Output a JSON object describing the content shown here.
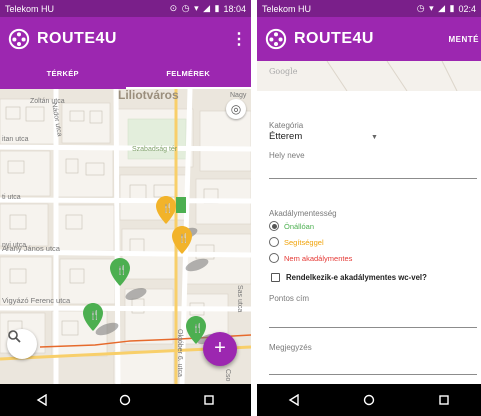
{
  "left": {
    "status": {
      "carrier": "Telekom HU",
      "icons": "⊙ ◷ ▾ ◢ ▮",
      "time": "18:04"
    },
    "appbar": {
      "brand": "ROUTE4U",
      "menu": "⋮"
    },
    "tabs": [
      {
        "label": "TÉRKÉP",
        "active": false
      },
      {
        "label": "FELMÉREK",
        "active": true
      }
    ],
    "map": {
      "streets": [
        "Zoltán utca",
        "Nádor utca",
        "Liliotváros",
        "Szabadság tér",
        "Arany János utca",
        "Vigyázó Ferenc utca",
        "Október 6. utca",
        "Sas utca",
        "Nagy",
        "itan utca",
        "nyi utca",
        "ti utca",
        "Cso"
      ],
      "pins": [
        "accessible",
        "partially-accessible",
        "partially-accessible",
        "accessible",
        "accessible",
        "accessible"
      ]
    },
    "colors": {
      "accessible": "#4caf50",
      "partial": "#f2b32a"
    }
  },
  "right": {
    "status": {
      "carrier": "Telekom HU",
      "icons": "◷ ▾ ◢ ▮",
      "time": "02:4"
    },
    "appbar": {
      "brand": "ROUTE4U",
      "save": "MENTÉ"
    },
    "map_watermark": "Google",
    "form": {
      "category_label": "Kategória",
      "category_value": "Étterem",
      "place_label": "Hely neve",
      "place_value": "",
      "accessibility_label": "Akadálymentesség",
      "options": [
        {
          "label": "Önállóan",
          "color": "#4caf50",
          "selected": true
        },
        {
          "label": "Segítséggel",
          "color": "#f0a30a",
          "selected": false
        },
        {
          "label": "Nem akadálymentes",
          "color": "#e53935",
          "selected": false
        }
      ],
      "wc_label": "Rendelkezik-e akadálymentes wc-vel?",
      "address_label": "Pontos cím",
      "address_value": "",
      "note_label": "Megjegyzés",
      "note_value": ""
    }
  },
  "colors": {
    "status_bar": "#7a1f8a",
    "app_bar": "#9c27b0",
    "accent": "#9c27b0"
  }
}
